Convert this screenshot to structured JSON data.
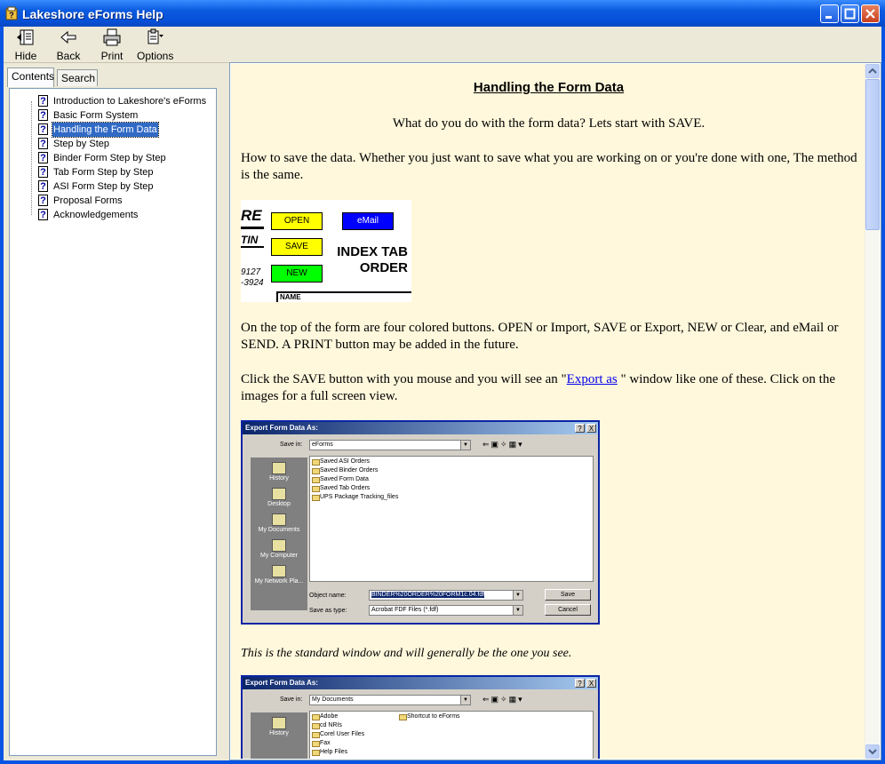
{
  "window": {
    "title": "Lakeshore eForms Help"
  },
  "toolbar": {
    "hide": "Hide",
    "back": "Back",
    "print": "Print",
    "options": "Options"
  },
  "nav": {
    "tabs": [
      "Contents",
      "Search"
    ],
    "items": [
      "Introduction to Lakeshore's eForms",
      "Basic Form System",
      "Handling the Form Data",
      "Step by Step",
      "Binder Form Step by Step",
      "Tab Form Step by Step",
      "ASI Form Step by Step",
      "Proposal Forms",
      "Acknowledgements"
    ],
    "selected": "Handling the Form Data"
  },
  "article": {
    "heading": "Handling the Form Data",
    "intro": "What do you do with the form data?  Lets start with SAVE.",
    "p1": "How to save the data.  Whether you just want to save what you are working on or you're done with one, The method is the same.",
    "p2": "On the top of the form are four colored buttons.  OPEN or Import, SAVE or Export, NEW or Clear, and eMail or SEND.  A PRINT button may be added in the future.",
    "p3_before": "Click the SAVE button with you mouse and you will see an \"",
    "p3_link": "Export as",
    "p3_after": " \" window like one of these.  Click on the images for a full screen view.",
    "caption1": "This is the standard window and will generally be the one you see."
  },
  "form_image": {
    "logo_fragment_1": "RE",
    "logo_fragment_2": "TIN",
    "phone_1": "9127",
    "phone_2": "-3924",
    "open": "OPEN",
    "save": "SAVE",
    "new": "NEW",
    "email": "eMail",
    "index_tab": "INDEX TAB",
    "order": "ORDER",
    "name": "NAME",
    "colors": {
      "open": "#ffff00",
      "save": "#ffff00",
      "new": "#00ff00",
      "email": "#0000ff"
    }
  },
  "dialog1": {
    "title": "Export Form Data As:",
    "help_btn": "?",
    "close_btn": "X",
    "save_in_label": "Save in:",
    "save_in_value": "eForms",
    "places": [
      "History",
      "Desktop",
      "My Documents",
      "My Computer",
      "My Network Pla..."
    ],
    "files": [
      "Saved ASI Orders",
      "Saved Binder Orders",
      "Saved Form Data",
      "Saved Tab Orders",
      "UPS Package Tracking_files"
    ],
    "object_name_label": "Object name:",
    "object_name_value": "BINDER%20ORDER%20FORM1c.04.fdf",
    "save_as_type_label": "Save as type:",
    "save_as_type_value": "Acrobat FDF Files (*.fdf)",
    "save": "Save",
    "cancel": "Cancel"
  },
  "dialog2": {
    "title": "Export Form Data As:",
    "help_btn": "?",
    "close_btn": "X",
    "save_in_label": "Save in:",
    "save_in_value": "My Documents",
    "places": [
      "History"
    ],
    "files_col1": [
      "Adobe",
      "cd NRIs",
      "Corel User Files",
      "Fax",
      "Help Files"
    ],
    "files_col2": [
      "Shortcut to eForms"
    ]
  }
}
